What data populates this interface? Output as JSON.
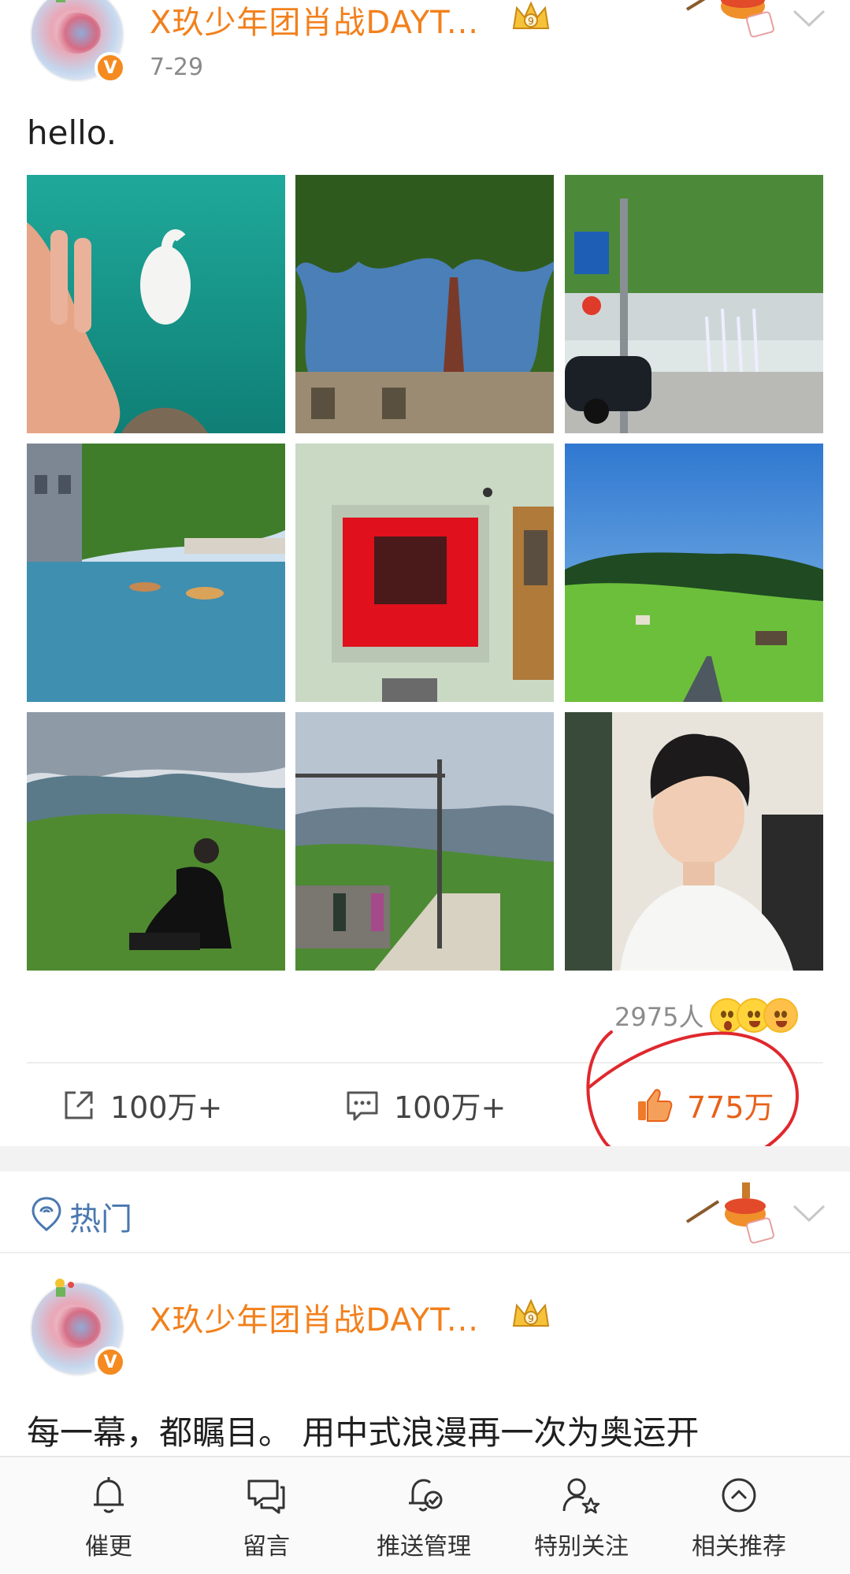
{
  "post1": {
    "username": "X玖少年团肖战DAYT...",
    "verified_badge": "V",
    "time": "7-29",
    "text": "hello.",
    "images": [
      "swan-hand",
      "tree-spire",
      "street-fountain",
      "canal-houses",
      "red-window",
      "green-hills",
      "seated-hillside",
      "railway-platform",
      "selfie-car"
    ],
    "reactions": {
      "count": "2975人"
    },
    "actions": {
      "repost": "100万+",
      "comment": "100万+",
      "like": "775万"
    }
  },
  "hot_section": {
    "label": "热门"
  },
  "post2": {
    "username": "X玖少年团肖战DAYT...",
    "verified_badge": "V",
    "text": "每一幕，都瞩目。 用中式浪漫再一次为奥运开"
  },
  "bottom_bar": [
    {
      "label": "催更",
      "icon": "bell-icon"
    },
    {
      "label": "留言",
      "icon": "message-icon"
    },
    {
      "label": "推送管理",
      "icon": "push-bell-icon"
    },
    {
      "label": "特别关注",
      "icon": "user-star-icon"
    },
    {
      "label": "相关推荐",
      "icon": "up-circle-icon"
    }
  ],
  "colors": {
    "accent_orange": "#f2801c",
    "like_orange": "#e8611a",
    "link_blue": "#4a78b0",
    "annotation_red": "#e0282e"
  }
}
